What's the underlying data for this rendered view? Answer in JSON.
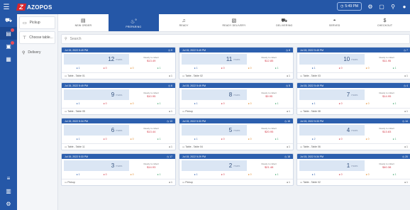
{
  "brand": {
    "mark": "Z",
    "name": "AZOPOS"
  },
  "topbar": {
    "time": "5:49 PM"
  },
  "left_panel": {
    "items": [
      {
        "label": "Pickup",
        "icon": "bag-icon"
      },
      {
        "label": "Choose table...",
        "icon": "table-icon"
      },
      {
        "label": "Delivery",
        "icon": "pin-icon"
      }
    ]
  },
  "tabs": [
    {
      "label": "NEW ORDER",
      "icon": "register-icon",
      "badge": ""
    },
    {
      "label": "PREPARING",
      "icon": "chef-icon",
      "badge": "9"
    },
    {
      "label": "READY",
      "icon": "bell-icon",
      "badge": ""
    },
    {
      "label": "READY DELIVERY",
      "icon": "receipt-icon",
      "badge": ""
    },
    {
      "label": "DELIVERING",
      "icon": "truck-icon",
      "badge": ""
    },
    {
      "label": "SERVED",
      "icon": "cloche-icon",
      "badge": ""
    },
    {
      "label": "CHECKOUT",
      "icon": "dollar-icon",
      "badge": ""
    }
  ],
  "search": {
    "placeholder": "Search"
  },
  "orders": [
    {
      "date": "Jul 15, 2022 5:49 PM",
      "id": "9",
      "items": "12",
      "unit": "ITEMS",
      "label": "Ready to collect",
      "amount": "$13.49",
      "stats": [
        "1",
        "0",
        "0",
        "1"
      ],
      "type": "Table - Table 01",
      "guests": "1"
    },
    {
      "date": "Jul 15, 2022 5:49 PM",
      "id": "8",
      "items": "11",
      "unit": "ITEMS",
      "label": "Ready to collect",
      "amount": "$12.85",
      "stats": [
        "1",
        "0",
        "0",
        "1"
      ],
      "type": "Table - Table 02",
      "guests": "1"
    },
    {
      "date": "Jul 15, 2022 5:49 PM",
      "id": "7",
      "items": "10",
      "unit": "ITEMS",
      "label": "Ready to collect",
      "amount": "$11.95",
      "stats": [
        "1",
        "0",
        "0",
        "1"
      ],
      "type": "Table - Table 03",
      "guests": "1"
    },
    {
      "date": "Jul 15, 2022 5:49 PM",
      "id": "6",
      "items": "9",
      "unit": "ITEMS",
      "label": "Ready to collect",
      "amount": "$10.95",
      "stats": [
        "1",
        "0",
        "0",
        "1"
      ],
      "type": "Table - Table 05",
      "guests": "1"
    },
    {
      "date": "Jul 15, 2022 5:49 PM",
      "id": "5",
      "items": "8",
      "unit": "ITEMS",
      "label": "Ready to collect",
      "amount": "$9.95",
      "stats": [
        "1",
        "0",
        "0",
        "1"
      ],
      "type": "Pickup",
      "guests": "1"
    },
    {
      "date": "Jul 15, 2022 5:49 PM",
      "id": "4",
      "items": "7",
      "unit": "ITEMS",
      "label": "Ready to collect",
      "amount": "$14.95",
      "stats": [
        "1",
        "0",
        "0",
        "1"
      ],
      "type": "Table - Table 08",
      "guests": "1"
    },
    {
      "date": "Jul 15, 2022 5:34 PM",
      "id": "13",
      "items": "6",
      "unit": "ITEMS",
      "label": "Ready to collect",
      "amount": "$13.44",
      "stats": [
        "1",
        "0",
        "0",
        "1"
      ],
      "type": "Table - Table 11",
      "guests": "1"
    },
    {
      "date": "Jul 15, 2022 5:33 PM",
      "id": "15",
      "items": "5",
      "unit": "ITEMS",
      "label": "Ready to collect",
      "amount": "$20.95",
      "stats": [
        "1",
        "0",
        "0",
        "1"
      ],
      "type": "Table - Table 04",
      "guests": "1"
    },
    {
      "date": "Jul 15, 2022 5:33 PM",
      "id": "14",
      "items": "4",
      "unit": "ITEMS",
      "label": "Ready to collect",
      "amount": "$13.83",
      "stats": [
        "2",
        "0",
        "0",
        "1"
      ],
      "type": "Table - Table 06",
      "guests": "1"
    },
    {
      "date": "Jul 15, 2022 5:33 PM",
      "id": "17",
      "items": "3",
      "unit": "ITEMS",
      "label": "Ready to collect",
      "amount": "$14.93",
      "stats": [
        "1",
        "0",
        "0",
        "1"
      ],
      "type": "Pickup",
      "guests": "1"
    },
    {
      "date": "Jul 15, 2022 5:29 PM",
      "id": "18",
      "items": "2",
      "unit": "ITEMS",
      "label": "Ready to collect",
      "amount": "$21.48",
      "stats": [
        "1",
        "0",
        "0",
        "1"
      ],
      "type": "Pickup",
      "guests": "1"
    },
    {
      "date": "Jul 15, 2022 5:34 PM",
      "id": "20",
      "items": "1",
      "unit": "ITEMS",
      "label": "Ready to collect",
      "amount": "$40.38",
      "stats": [
        "1",
        "0",
        "0",
        "1"
      ],
      "type": "Table - Table 02",
      "guests": "1"
    }
  ],
  "colors": {
    "brand": "#2557a7",
    "accent_red": "#d9262d"
  }
}
